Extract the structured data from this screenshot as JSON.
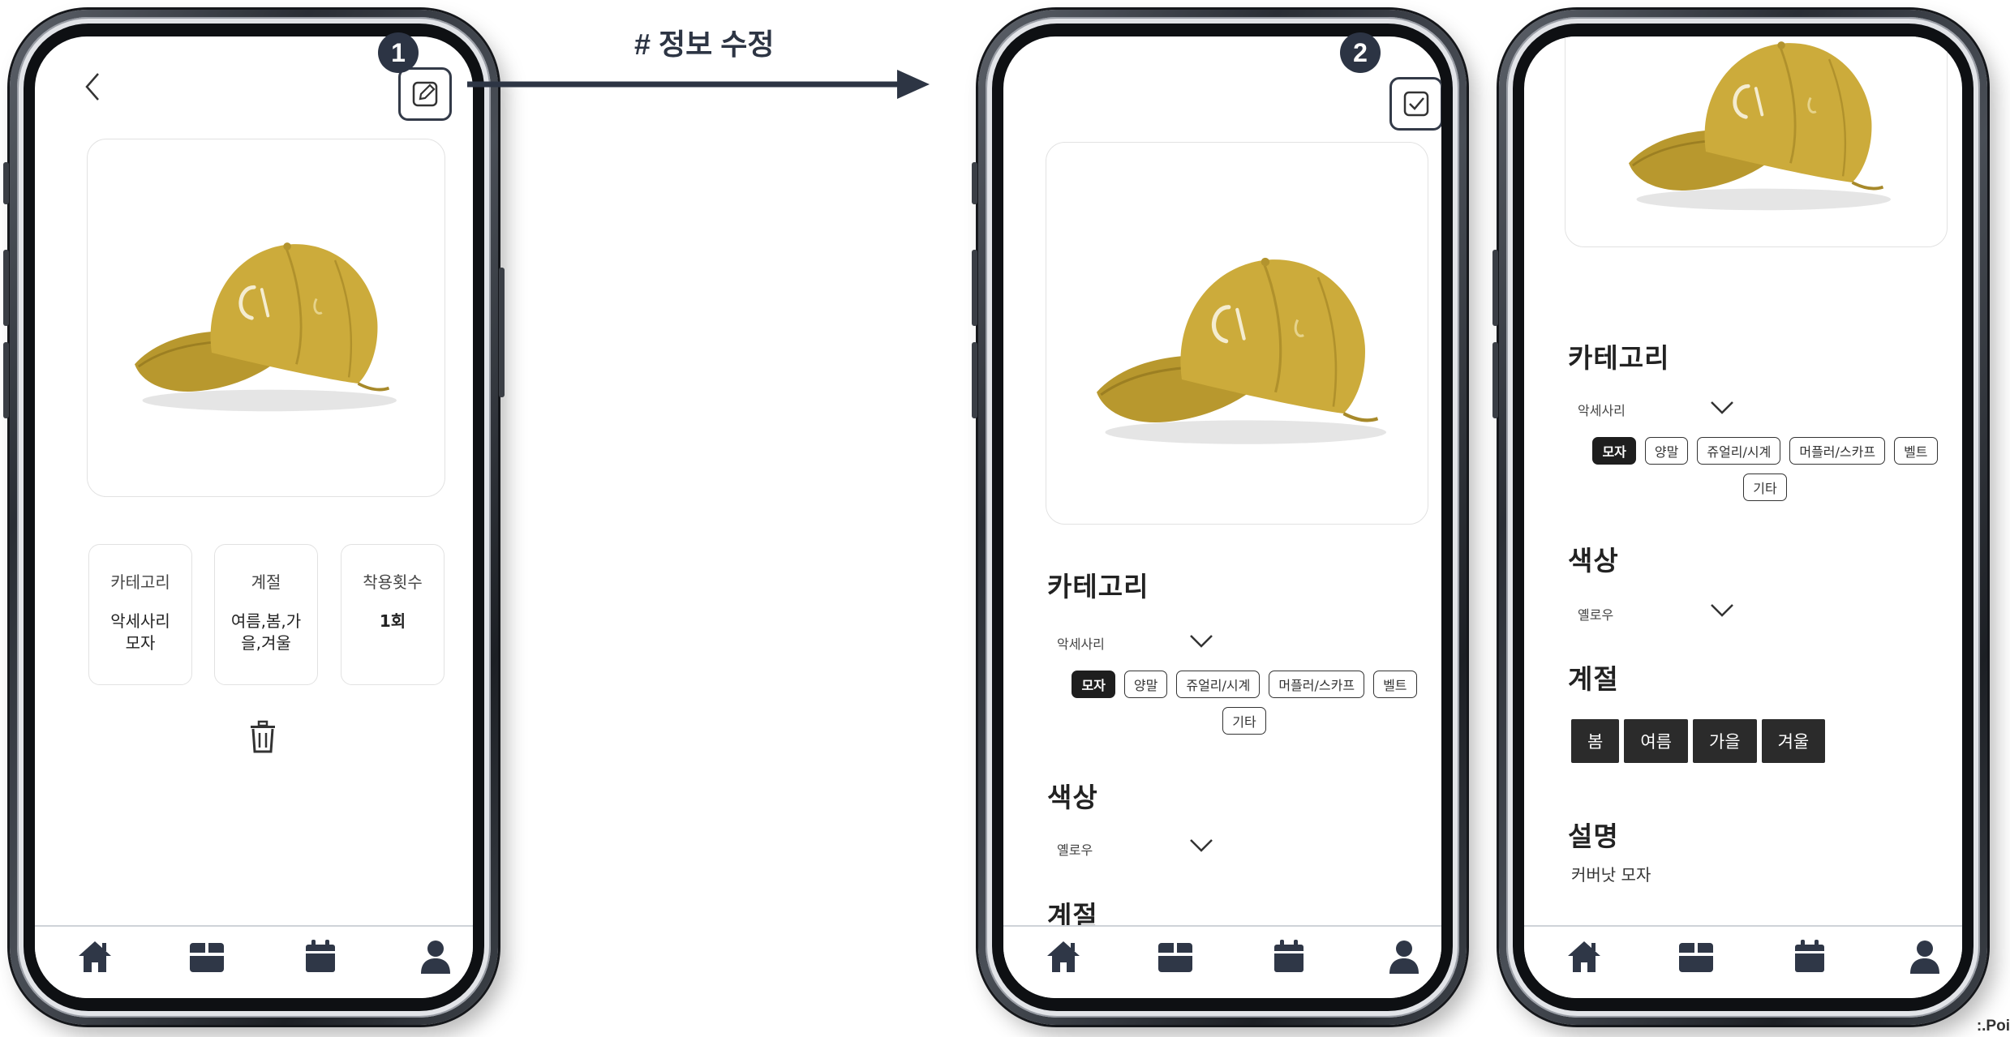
{
  "annotation": {
    "title": "# 정보 수정",
    "step1": "1",
    "step2": "2"
  },
  "detail": {
    "cards": [
      {
        "label": "카테고리",
        "value": [
          "악세사리",
          "모자"
        ]
      },
      {
        "label": "계절",
        "value": [
          "여름,봄,가",
          "을,겨울"
        ]
      },
      {
        "label": "착용횟수",
        "value": [
          "1회"
        ]
      }
    ]
  },
  "edit": {
    "category_title": "카테고리",
    "category_value": "악세사리",
    "subcategories": [
      "모자",
      "양말",
      "쥬얼리/시계",
      "머플러/스카프",
      "벨트",
      "기타"
    ],
    "selected_subcategory": "모자",
    "color_title": "색상",
    "color_value": "옐로우",
    "season_title": "계절",
    "seasons": [
      "봄",
      "여름",
      "가을",
      "겨울"
    ],
    "description_title": "설명",
    "description_value": "커버낫 모자"
  },
  "navbar": {
    "items": [
      "home-icon",
      "closet-icon",
      "calendar-icon",
      "profile-icon"
    ],
    "active": "closet-icon"
  },
  "colors": {
    "accent": "#2c3444",
    "cap": "#c9a93a",
    "chip_selected": "#1e1e1e"
  },
  "watermark": ":.Poi"
}
